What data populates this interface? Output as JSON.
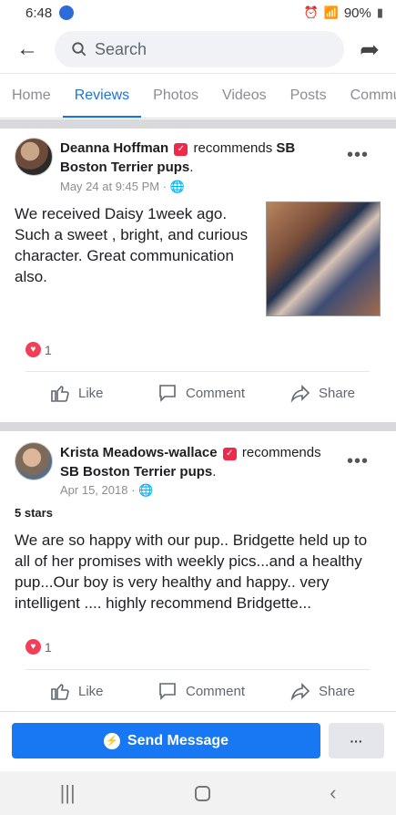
{
  "status": {
    "time": "6:48",
    "battery": "90%"
  },
  "search": {
    "placeholder": "Search"
  },
  "tabs": [
    "Home",
    "Reviews",
    "Photos",
    "Videos",
    "Posts",
    "Commu"
  ],
  "reviews": [
    {
      "author": "Deanna Hoffman",
      "verb": "recommends",
      "page": "SB Boston Terrier pups",
      "date": "May 24 at 9:45 PM",
      "stars": "",
      "text": "We received Daisy 1week ago. Such a sweet , bright, and curious character. Great communication also.",
      "reaction_count": "1"
    },
    {
      "author": "Krista Meadows-wallace",
      "verb": "recommends",
      "page": "SB Boston Terrier pups",
      "date": "Apr 15, 2018",
      "stars": "5 stars",
      "text": "We are so happy with our pup.. Bridgette held up to all of her promises with weekly pics...and a healthy pup...Our boy is very healthy and happy.. very intelligent .... highly recommend Bridgette...",
      "reaction_count": "1"
    }
  ],
  "actions": {
    "like": "Like",
    "comment": "Comment",
    "share": "Share"
  },
  "bottom": {
    "send_message": "Send Message",
    "more": "···"
  }
}
